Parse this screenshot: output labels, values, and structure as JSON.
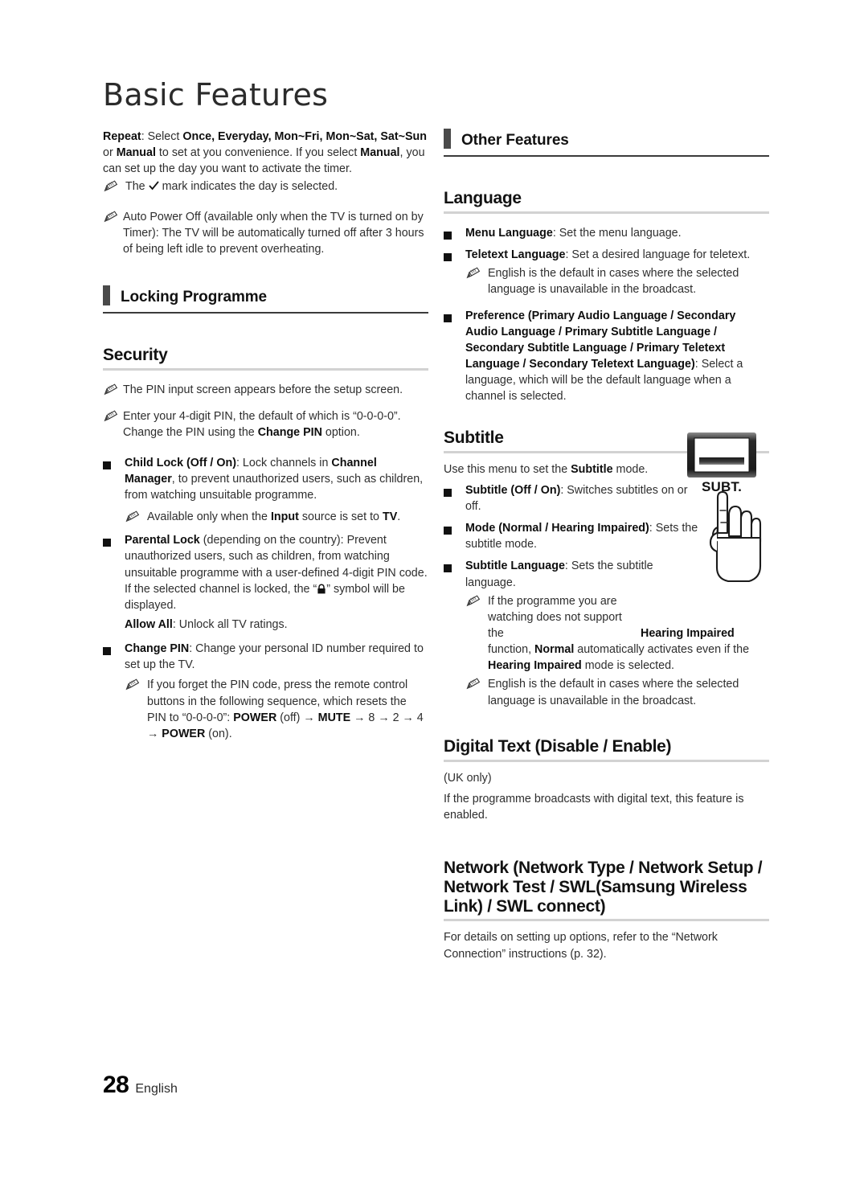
{
  "page": {
    "title": "Basic Features",
    "number": "28",
    "language": "English"
  },
  "left_column": {
    "repeat_block": {
      "line1_bold": "Repeat",
      "line1_rest": ": Select ",
      "options_1": "Once, Everyday, Mon~Fri, Mon~Sat, Sat~Sun",
      "mid": " or ",
      "options_2": "Manual",
      "rest": " to set at you convenience. If you select ",
      "manual": "Manual",
      "tail": ", you can set up the day you want to activate the timer."
    },
    "repeat_note": {
      "pre": "The ",
      "icon": "check-mark-icon",
      "post": " mark indicates the day is selected."
    },
    "auto_power_off_note": "Auto Power Off (available only when the TV is turned on by Timer): The TV will be automatically turned off after 3 hours of being left idle to prevent overheating.",
    "section_header": "Locking Programme",
    "security_heading": "Security",
    "security_note_1": "The PIN input screen appears before the setup screen.",
    "security_note_2": {
      "pre": "Enter your 4-digit PIN, the default of which is “0-0-0-0”. Change the PIN using the ",
      "bold": "Change PIN",
      "post": " option."
    },
    "child_lock": {
      "bold_1": "Child Lock (Off / On)",
      "text_1": ": Lock channels in ",
      "bold_2": "Channel Manager",
      "text_2": ", to prevent unauthorized users, such as children, from watching unsuitable programme.",
      "note": {
        "pre": "Available only when the ",
        "bold_1": "Input",
        "mid": " source is set to ",
        "bold_2": "TV",
        "post": "."
      }
    },
    "parental_lock": {
      "bold_1": "Parental Lock",
      "text_1": " (depending on the country): Prevent unauthorized users, such as children, from watching unsuitable programme with a user-defined 4-digit PIN code. If the selected channel is locked, the “",
      "icon": "padlock-icon",
      "text_2": "” symbol will be displayed.",
      "allow_all_bold": "Allow All",
      "allow_all_text": ": Unlock all TV ratings."
    },
    "change_pin": {
      "bold": "Change PIN",
      "text": ": Change your personal ID number required to set up the TV.",
      "note": {
        "pre": "If you forget the PIN code, press the remote control buttons in the following sequence, which resets the PIN to “0-0-0-0”: ",
        "b1": "POWER",
        "t1": " (off) → ",
        "b2": "MUTE",
        "t2": " → 8 → 2 → 4 → ",
        "b3": "POWER",
        "t3": " (on)."
      }
    }
  },
  "right_column": {
    "section_header": "Other Features",
    "language_heading": "Language",
    "menu_language": {
      "bold": "Menu Language",
      "text": ": Set the menu language."
    },
    "teletext_language": {
      "bold": "Teletext Language",
      "text": ": Set a desired language for teletext."
    },
    "teletext_note": "English is the default in cases where the selected language is unavailable in the broadcast.",
    "preference": {
      "bold": "Preference (Primary Audio Language / Secondary Audio Language / Primary Subtitle Language / Secondary Subtitle Language / Primary Teletext Language / Secondary Teletext Language)",
      "text": ": Select a language, which will be the default language when a channel is selected."
    },
    "subtitle_heading": "Subtitle",
    "subtitle_intro": {
      "pre": "Use this menu to set the ",
      "bold": "Subtitle",
      "post": " mode."
    },
    "subtitle_offon": {
      "bold": "Subtitle (Off / On)",
      "text": ": Switches subtitles on or off."
    },
    "subtitle_mode": {
      "bold": "Mode (Normal / Hearing Impaired)",
      "text": ": Sets the subtitle mode."
    },
    "subtitle_language": {
      "bold": "Subtitle Language",
      "text": ": Sets the subtitle language."
    },
    "subtitle_note_1": {
      "p1": "If the programme you are watching does not support the ",
      "b1": "Hearing Impaired",
      "p2": " function, ",
      "b2": "Normal",
      "p3": " automatically activates even if the ",
      "b3": "Hearing Impaired",
      "p4": " mode is selected."
    },
    "subtitle_note_2": "English is the default in cases where the selected language is unavailable in the broadcast.",
    "digital_text_heading": "Digital Text (Disable / Enable)",
    "digital_text_uk": "(UK only)",
    "digital_text_body": "If the programme broadcasts with digital text, this feature is enabled.",
    "network_heading": "Network (Network Type / Network Setup / Network Test / SWL(Samsung Wireless Link) / SWL connect)",
    "network_body": "For details on setting up options, refer to the “Network Connection” instructions (p. 32)."
  },
  "figure": {
    "button_label": "SUBT.",
    "icons": [
      "subtitle-button-icon",
      "pointing-hand-icon"
    ]
  },
  "colors": {
    "text": "#2e2e2e",
    "bold_text": "#0e0e0e",
    "section_bar": "#4a4a4a",
    "section_rule": "#3b3b3b",
    "sub_rule": "#d2d2d2"
  }
}
